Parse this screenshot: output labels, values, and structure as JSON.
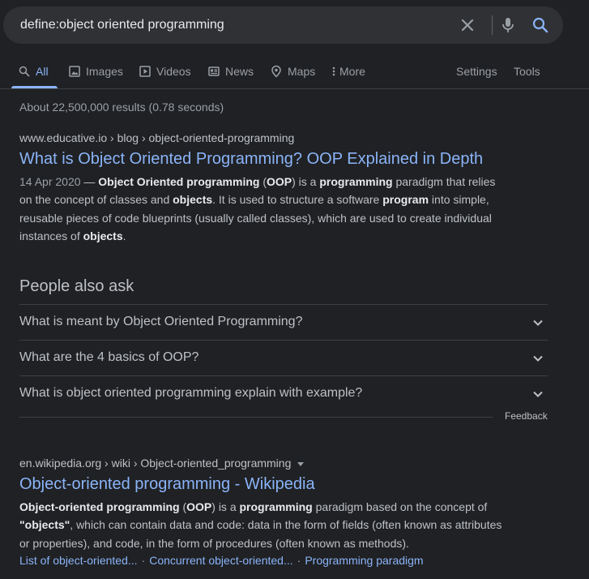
{
  "search": {
    "query": "define:object oriented programming"
  },
  "tabs": [
    {
      "label": "All",
      "icon": "search-icon"
    },
    {
      "label": "Images",
      "icon": "image-icon"
    },
    {
      "label": "Videos",
      "icon": "video-icon"
    },
    {
      "label": "News",
      "icon": "news-icon"
    },
    {
      "label": "Maps",
      "icon": "map-pin-icon"
    },
    {
      "label": "More",
      "icon": "more-vert-icon"
    }
  ],
  "tools": {
    "settings": "Settings",
    "tools": "Tools"
  },
  "stats": "About 22,500,000 results (0.78 seconds)",
  "results": [
    {
      "breadcrumb": "www.educative.io › blog › object-oriented-programming",
      "title": "What is Object Oriented Programming? OOP Explained in Depth",
      "date": "14 Apr 2020",
      "snippet_lines": [
        [
          {
            "t": " — "
          },
          {
            "t": "Object Oriented programming",
            "b": true
          },
          {
            "t": " ("
          },
          {
            "t": "OOP",
            "b": true
          },
          {
            "t": ") is a "
          },
          {
            "t": "programming",
            "b": true
          },
          {
            "t": " paradigm that relies"
          }
        ],
        [
          {
            "t": "on the concept of classes and "
          },
          {
            "t": "objects",
            "b": true
          },
          {
            "t": ". It is used to structure a software "
          },
          {
            "t": "program",
            "b": true
          },
          {
            "t": " into simple,"
          }
        ],
        [
          {
            "t": "reusable pieces of code blueprints (usually called classes), which are used to create individual"
          }
        ],
        [
          {
            "t": "instances of "
          },
          {
            "t": "objects",
            "b": true
          },
          {
            "t": "."
          }
        ]
      ]
    },
    {
      "breadcrumb": "en.wikipedia.org › wiki › Object-oriented_programming",
      "title": "Object-oriented programming - Wikipedia",
      "snippet_lines": [
        [
          {
            "t": "Object-oriented programming",
            "b": true
          },
          {
            "t": " ("
          },
          {
            "t": "OOP",
            "b": true
          },
          {
            "t": ") is a "
          },
          {
            "t": "programming",
            "b": true
          },
          {
            "t": " paradigm based on the concept of"
          }
        ],
        [
          {
            "t": "\"objects\"",
            "b": true
          },
          {
            "t": ", which can contain data and code: data in the form of fields (often known as attributes"
          }
        ],
        [
          {
            "t": "or properties), and code, in the form of procedures (often known as methods)."
          }
        ]
      ],
      "sitelinks": [
        "List of object-oriented...",
        "Concurrent object-oriented...",
        "Programming paradigm"
      ]
    }
  ],
  "paa": {
    "heading": "People also ask",
    "questions": [
      "What is meant by Object Oriented Programming?",
      "What are the 4 basics of OOP?",
      "What is object oriented programming explain with example?"
    ],
    "feedback": "Feedback"
  },
  "colors": {
    "background": "#202124",
    "link": "#8ab4f8",
    "text": "#bdc1c6"
  }
}
